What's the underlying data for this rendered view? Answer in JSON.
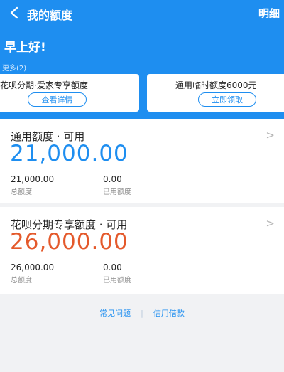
{
  "header": {
    "title": "我的额度",
    "detail_label": "明细",
    "greeting": "早上好!",
    "more_label": "更多",
    "more_count": "(2)"
  },
  "promos": [
    {
      "text": "花呗分期·爱家专享额度",
      "button": "查看详情"
    },
    {
      "text": "通用临时额度6000元",
      "button": "立即领取"
    }
  ],
  "cards": [
    {
      "title": "通用额度 · 可用",
      "amount": "21,000.00",
      "total_value": "21,000.00",
      "total_label": "总额度",
      "used_value": "0.00",
      "used_label": "已用额度"
    },
    {
      "title": "花呗分期专享额度 · 可用",
      "amount": "26,000.00",
      "total_value": "26,000.00",
      "total_label": "总额度",
      "used_value": "0.00",
      "used_label": "已用额度"
    }
  ],
  "footer": {
    "faq_label": "常见问题",
    "separator": "|",
    "credit_loan_label": "信用借款"
  },
  "colors": {
    "brand_blue": "#1e8ef0",
    "amount_orange": "#e4592b"
  }
}
